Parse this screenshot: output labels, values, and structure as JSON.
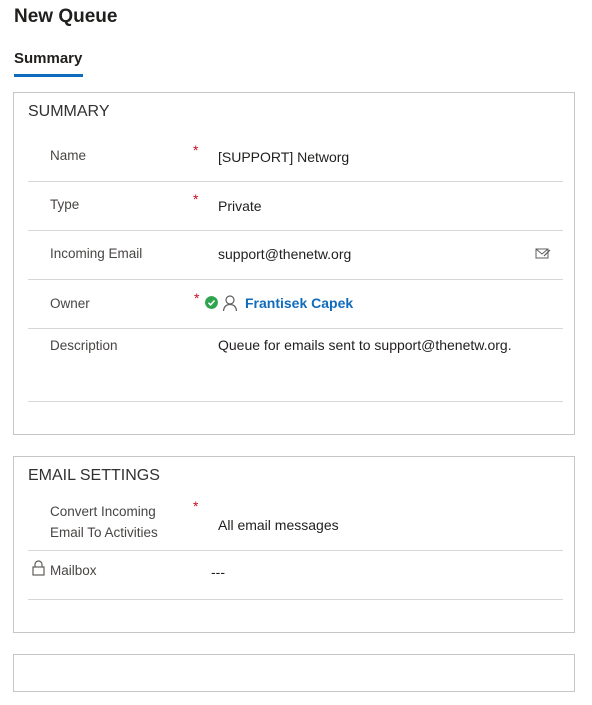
{
  "page": {
    "title": "New Queue"
  },
  "tabs": [
    {
      "label": "Summary",
      "active": true
    }
  ],
  "summary": {
    "title": "SUMMARY",
    "fields": {
      "name": {
        "label": "Name",
        "required": "*",
        "value": "[SUPPORT] Networg"
      },
      "type": {
        "label": "Type",
        "required": "*",
        "value": "Private"
      },
      "incoming_email": {
        "label": "Incoming Email",
        "value": "support@thenetw.org",
        "icon": "email-compose-icon"
      },
      "owner": {
        "label": "Owner",
        "required": "*",
        "value": "Frantisek Capek",
        "status_icon": "check-circle-icon",
        "person_icon": "person-icon"
      },
      "description": {
        "label": "Description",
        "value": "Queue for emails sent to support@thenetw.org."
      }
    }
  },
  "email_settings": {
    "title": "EMAIL SETTINGS",
    "fields": {
      "convert": {
        "label_line1": "Convert Incoming",
        "label_line2": "Email To Activities",
        "required": "*",
        "value": "All email messages"
      },
      "mailbox": {
        "label": "Mailbox",
        "value": "---",
        "icon": "lock-icon"
      }
    }
  },
  "colors": {
    "accent": "#0f6cbd",
    "required": "#c50f1f",
    "success": "#2ea44f",
    "border": "#c8c6c4"
  }
}
